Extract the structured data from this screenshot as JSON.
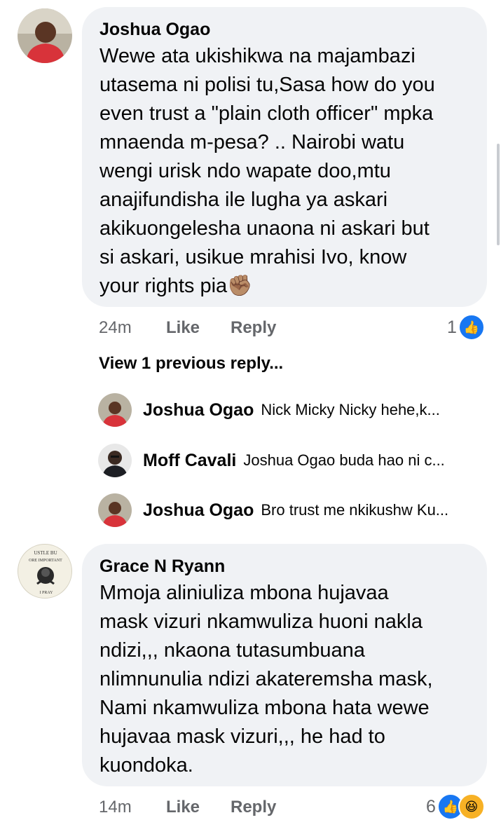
{
  "comments": [
    {
      "author": "Joshua Ogao",
      "text": "Wewe ata ukishikwa na majambazi\nutasema ni polisi tu,Sasa how do you\neven trust a \"plain cloth officer\" mpka\nmnaenda m-pesa? .. Nairobi watu\nwengi urisk ndo wapate doo,mtu\nanajifundisha ile lugha ya askari\nakikuongelesha unaona ni askari but\nsi askari, usikue mrahisi Ivo, know\nyour rights pia",
      "emoji": "✊🏽",
      "time": "24m",
      "like_label": "Like",
      "reply_label": "Reply",
      "reaction_count": "1",
      "view_previous": "View 1 previous reply...",
      "replies": [
        {
          "author": "Joshua Ogao",
          "snippet": "Nick Micky Nicky hehe,k..."
        },
        {
          "author": "Moff Cavali",
          "snippet": "Joshua Ogao buda hao ni c..."
        },
        {
          "author": "Joshua Ogao",
          "snippet": "Bro trust me nkikushw Ku..."
        }
      ]
    },
    {
      "author": "Grace N Ryann",
      "avatar_text_top": "USTLE BU",
      "avatar_text_mid": "ORE IMPORTANT",
      "avatar_text_bottom": "I PRAY",
      "text": "Mmoja aliniuliza mbona hujavaa\nmask vizuri nkamwuliza huoni nakla\nndizi,,, nkaona tutasumbuana\nnlimnunulia ndizi akateremsha mask,\nNami nkamwuliza mbona hata wewe\nhujavaa mask vizuri,,, he had to\nkuondoka.",
      "time": "14m",
      "like_label": "Like",
      "reply_label": "Reply",
      "reaction_count": "6"
    }
  ],
  "colors": {
    "bubble": "#f0f2f5",
    "meta": "#65676b",
    "like_blue": "#1877f2",
    "haha_yellow": "#f7b125"
  }
}
